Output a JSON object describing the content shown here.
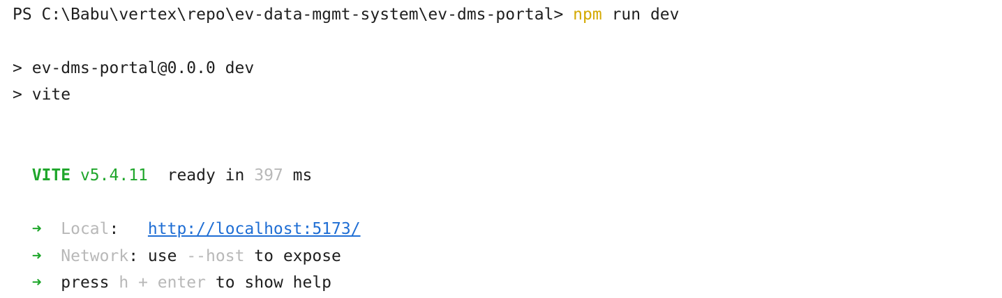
{
  "terminal": {
    "command": {
      "prompt": "PS C:\\Babu\\vertex\\repo\\ev-data-mgmt-system\\ev-dms-portal>",
      "program": "npm",
      "args": "run dev"
    },
    "script_lines": [
      {
        "marker": ">",
        "text": "ev-dms-portal@0.0.0 dev"
      },
      {
        "marker": ">",
        "text": "vite"
      }
    ],
    "vite_banner": {
      "name": "VITE",
      "version": "v5.4.11",
      "ready_label": "ready in",
      "ready_time": "397",
      "unit": "ms"
    },
    "local": {
      "arrow": "➜",
      "label": "Local",
      "colon": ":",
      "url": "http://localhost:5173/"
    },
    "network": {
      "arrow": "➜",
      "label": "Network",
      "colon": ":",
      "text1": "use",
      "flag": "--host",
      "text2": "to expose"
    },
    "help": {
      "arrow": "➜",
      "text1": "press",
      "key": "h + enter",
      "text2": "to show help"
    }
  }
}
